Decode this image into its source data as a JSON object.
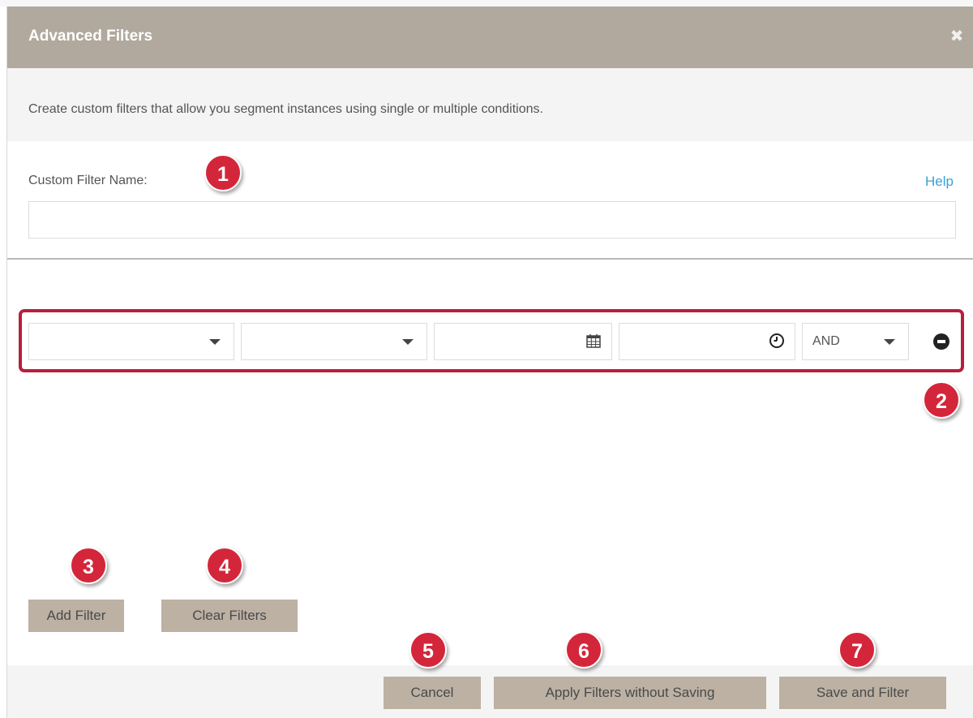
{
  "dialog": {
    "title": "Advanced Filters",
    "close_icon": "close-icon",
    "description": "Create custom filters that allow you segment instances using single or multiple conditions.",
    "name_label": "Custom Filter Name:",
    "help_label": "Help",
    "name_value": "",
    "name_placeholder": ""
  },
  "filter_row": {
    "field1_value": "",
    "field2_value": "",
    "date_value": "",
    "time_value": "",
    "logic_value": "AND",
    "highlight_color": "#b81f3c"
  },
  "actions": {
    "add_filter": "Add Filter",
    "clear_filters": "Clear Filters"
  },
  "footer": {
    "cancel": "Cancel",
    "apply_without_saving": "Apply Filters without Saving",
    "save_and_filter": "Save and Filter"
  },
  "badges": [
    "1",
    "2",
    "3",
    "4",
    "5",
    "6",
    "7"
  ],
  "colors": {
    "header_bg": "#b1a89e",
    "button_bg": "#bcb1a3",
    "badge_bg": "#d4263a",
    "link": "#3aa1d8"
  }
}
